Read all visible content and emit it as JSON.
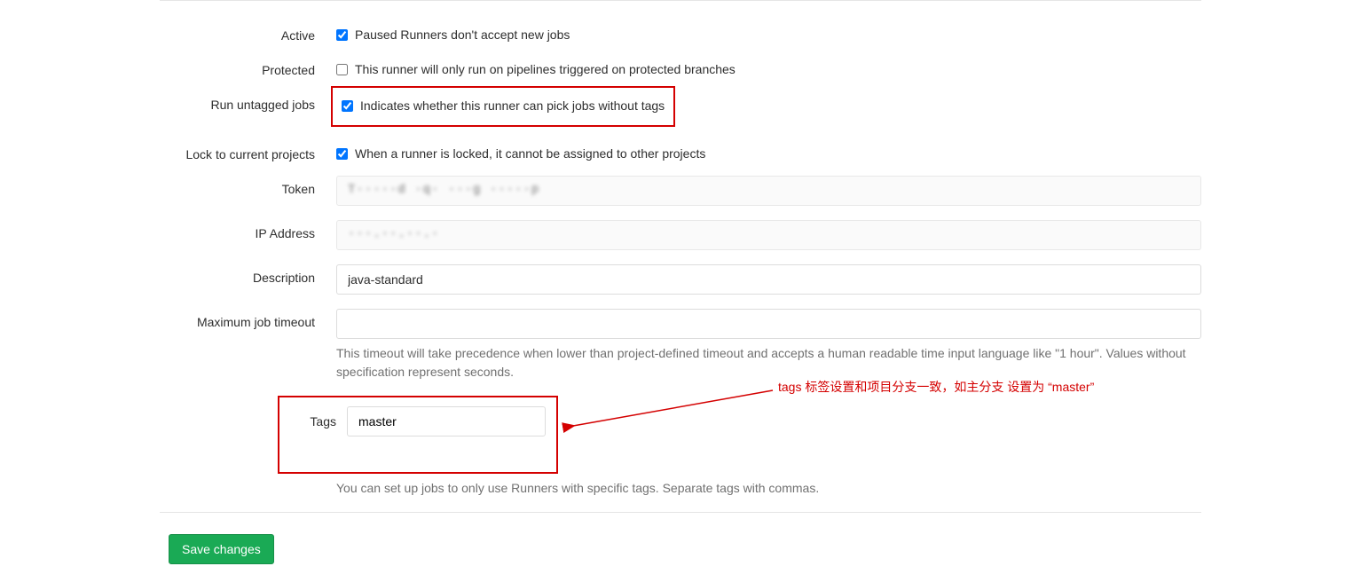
{
  "labels": {
    "active": "Active",
    "protected": "Protected",
    "run_untagged": "Run untagged jobs",
    "lock_projects": "Lock to current projects",
    "token": "Token",
    "ip_address": "IP Address",
    "description": "Description",
    "max_timeout": "Maximum job timeout",
    "tags": "Tags"
  },
  "checkboxes": {
    "active": {
      "checked": true,
      "text": "Paused Runners don't accept new jobs"
    },
    "protected": {
      "checked": false,
      "text": "This runner will only run on pipelines triggered on protected branches"
    },
    "run_untagged": {
      "checked": true,
      "text": "Indicates whether this runner can pick jobs without tags"
    },
    "lock_projects": {
      "checked": true,
      "text": "When a runner is locked, it cannot be assigned to other projects"
    }
  },
  "fields": {
    "token": "T·····d ·q· ···g ·····p",
    "ip_address": "···.··.··.·",
    "description": "java-standard",
    "max_timeout": "",
    "tags": "master"
  },
  "help": {
    "timeout": "This timeout will take precedence when lower than project-defined timeout and accepts a human readable time input language like \"1 hour\". Values without specification represent seconds.",
    "tags": "You can set up jobs to only use Runners with specific tags. Separate tags with commas."
  },
  "annotation": "tags 标签设置和项目分支一致，如主分支 设置为 “master”",
  "buttons": {
    "save": "Save changes"
  }
}
